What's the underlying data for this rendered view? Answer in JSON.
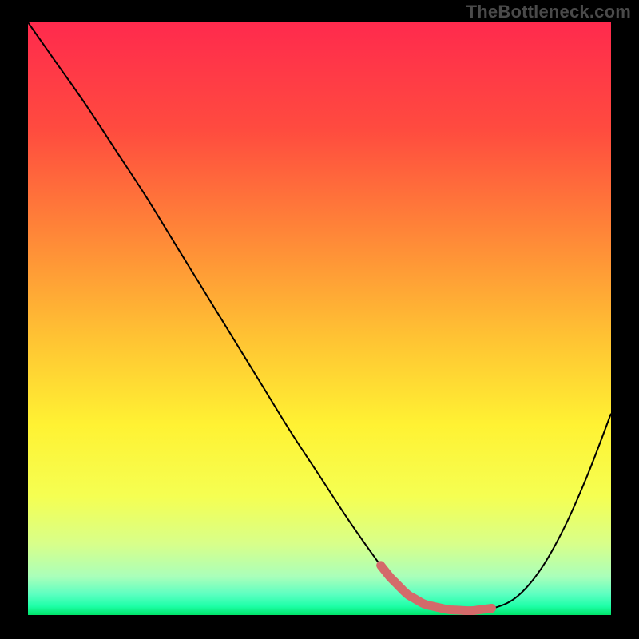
{
  "watermark": "TheBottleneck.com",
  "chart_data": {
    "type": "line",
    "title": "",
    "xlabel": "",
    "ylabel": "",
    "xlim": [
      0,
      100
    ],
    "ylim": [
      0,
      100
    ],
    "background_gradient": {
      "stops": [
        {
          "offset": 0.0,
          "color": "#ff2a4d"
        },
        {
          "offset": 0.18,
          "color": "#ff4b3f"
        },
        {
          "offset": 0.35,
          "color": "#ff8438"
        },
        {
          "offset": 0.53,
          "color": "#ffc233"
        },
        {
          "offset": 0.68,
          "color": "#fff233"
        },
        {
          "offset": 0.8,
          "color": "#f5ff52"
        },
        {
          "offset": 0.88,
          "color": "#d8ff8a"
        },
        {
          "offset": 0.935,
          "color": "#aaffba"
        },
        {
          "offset": 0.965,
          "color": "#5dffc1"
        },
        {
          "offset": 0.985,
          "color": "#1effa8"
        },
        {
          "offset": 1.0,
          "color": "#00e46a"
        }
      ]
    },
    "series": [
      {
        "name": "bottleneck-curve",
        "color": "#000000",
        "width": 2,
        "x": [
          0,
          5,
          10,
          15,
          20,
          25,
          30,
          35,
          40,
          45,
          50,
          55,
          60,
          62,
          65,
          68,
          72,
          76,
          80,
          84,
          88,
          92,
          96,
          100
        ],
        "y": [
          100,
          93,
          86,
          78.5,
          71,
          63,
          55,
          47,
          39,
          31,
          23.5,
          16,
          9,
          6.5,
          3.5,
          1.8,
          0.9,
          0.7,
          1.2,
          3.2,
          7.8,
          14.8,
          23.7,
          34
        ]
      }
    ],
    "highlight_band": {
      "name": "optimal-range",
      "color": "#d46a6a",
      "x_start": 60.5,
      "x_end": 79.5,
      "dot_x": 79.5
    }
  }
}
